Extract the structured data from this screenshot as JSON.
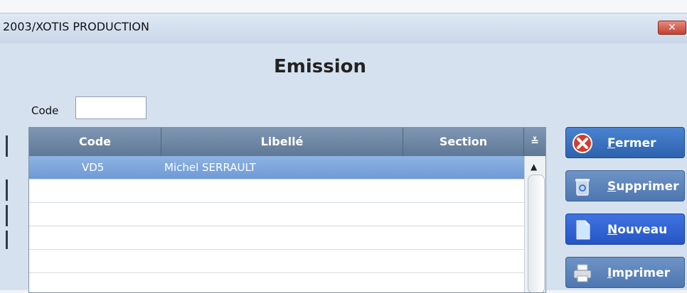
{
  "window": {
    "title": "2003/XOTIS PRODUCTION",
    "close_label": "✕"
  },
  "form": {
    "title": "Emission",
    "code_label": "Code",
    "code_value": ""
  },
  "grid": {
    "columns": [
      "Code",
      "Libellé",
      "Section"
    ],
    "sort_glyph": "≚",
    "rows": [
      {
        "code": "VD5",
        "libelle": "Michel SERRAULT",
        "section": ""
      }
    ],
    "scroll_up_glyph": "▲"
  },
  "actions": {
    "close": {
      "accel": "F",
      "rest": "ermer"
    },
    "delete": {
      "accel": "S",
      "rest": "upprimer"
    },
    "new": {
      "accel": "N",
      "rest": "ouveau"
    },
    "print": {
      "accel": "I",
      "rest": "mprimer"
    }
  },
  "colors": {
    "window_bg": "#d5e1ee",
    "header_bg": "#6d87a6",
    "selected_row": "#7ea6dc",
    "close_red": "#d93a2b"
  }
}
